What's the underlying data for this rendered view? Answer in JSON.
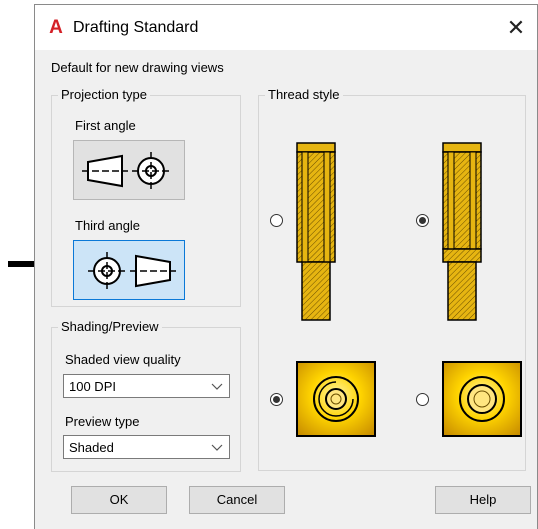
{
  "window": {
    "title": "Drafting Standard",
    "logo_letter": "A",
    "close_glyph": "✕"
  },
  "subtitle": "Default for new drawing views",
  "projection": {
    "group_label": "Projection type",
    "first_angle_label": "First angle",
    "third_angle_label": "Third angle",
    "selected": "Third angle"
  },
  "shading": {
    "group_label": "Shading/Preview",
    "quality_label": "Shaded view quality",
    "quality_value": "100 DPI",
    "preview_label": "Preview type",
    "preview_value": "Shaded"
  },
  "thread": {
    "group_label": "Thread style",
    "options": [
      {
        "style": "hatched-full-length",
        "selected": false
      },
      {
        "style": "hatched-partial-length",
        "selected": true
      },
      {
        "style": "end-view-shaded",
        "selected": true
      },
      {
        "style": "end-view-plain",
        "selected": false
      }
    ]
  },
  "buttons": {
    "ok": "OK",
    "cancel": "Cancel",
    "help": "Help"
  },
  "colors": {
    "thread_gold": "#e6b511",
    "selection_blue": "#0a78d7",
    "logo_red": "#d42027"
  }
}
